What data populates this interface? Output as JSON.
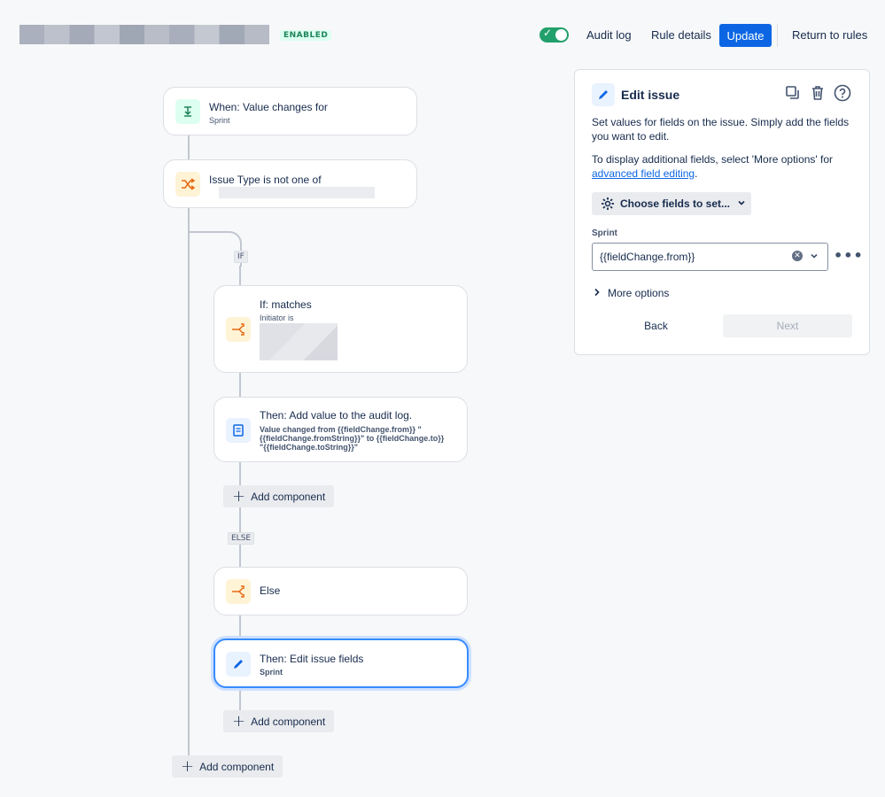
{
  "header": {
    "status_badge": "ENABLED",
    "audit_log": "Audit log",
    "rule_details": "Rule details",
    "update": "Update",
    "return_to_rules": "Return to rules"
  },
  "flow": {
    "trigger": {
      "title": "When: Value changes for",
      "subtitle": "Sprint",
      "icon": "download-icon"
    },
    "condition": {
      "title": "Issue Type is not one of",
      "icon": "shuffle-icon"
    },
    "if_label": "IF",
    "if_block": {
      "title": "If: matches",
      "subtitle": "Initiator is",
      "icon": "branch-icon"
    },
    "audit_action": {
      "title": "Then: Add value to the audit log.",
      "detail_line1": "Value changed from {{fieldChange.from}} \"",
      "detail_line2": "{{fieldChange.fromString}}\" to {{fieldChange.to}}",
      "detail_line3": "\"{{fieldChange.toString}}\"",
      "icon": "document-icon"
    },
    "add_component_1": "Add component",
    "else_label": "ELSE",
    "else_block": {
      "title": "Else",
      "icon": "branch-icon"
    },
    "edit_action": {
      "title": "Then: Edit issue fields",
      "subtitle": "Sprint",
      "icon": "pencil-icon"
    },
    "add_component_2": "Add component",
    "add_component_3": "Add component"
  },
  "panel": {
    "title": "Edit issue",
    "desc1": "Set values for fields on the issue. Simply add the fields you want to edit.",
    "desc2_prefix": "To display additional fields, select 'More options' for",
    "desc2_link": "advanced field editing",
    "desc2_suffix": ".",
    "choose_fields": "Choose fields to set...",
    "field_label": "Sprint",
    "field_value": "{{fieldChange.from}}",
    "more_options": "More options",
    "back": "Back",
    "next": "Next"
  },
  "colors": {
    "accent": "#0c66e4",
    "toggle_on": "#22a06b",
    "selected_border": "#388bff"
  }
}
